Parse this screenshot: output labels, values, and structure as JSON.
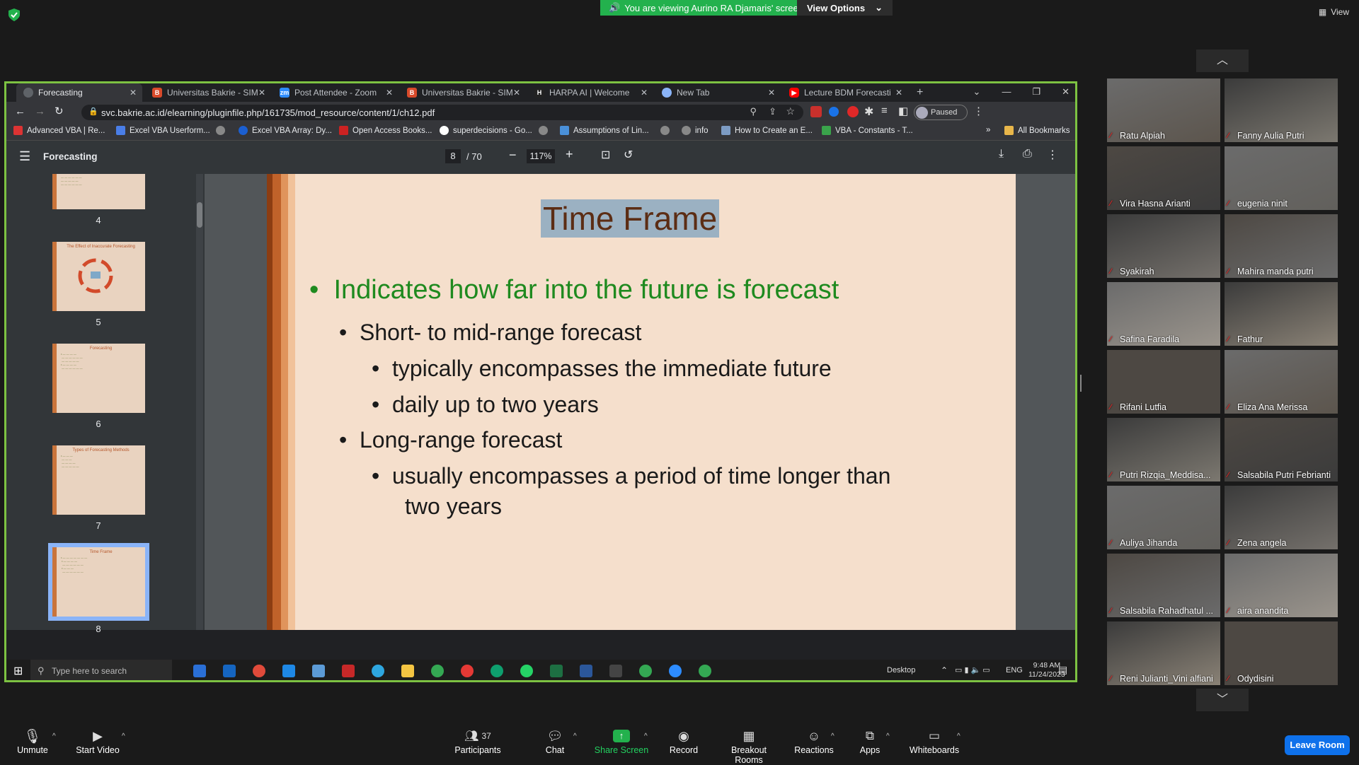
{
  "zoom": {
    "banner": "You are viewing Aurino RA Djamaris' screen",
    "view_options": "View Options",
    "view": "View",
    "bottom": {
      "unmute": "Unmute",
      "start_video": "Start Video",
      "participants": "Participants",
      "participants_count": "37",
      "chat": "Chat",
      "share_screen": "Share Screen",
      "record": "Record",
      "breakout": "Breakout Rooms",
      "reactions": "Reactions",
      "apps": "Apps",
      "whiteboards": "Whiteboards",
      "leave": "Leave Room"
    },
    "participants": [
      "Ratu Alpiah",
      "Fanny Aulia Putri",
      "Vira Hasna Arianti",
      "eugenia ninit",
      "Syakirah",
      "Mahira manda putri",
      "Safina Faradila",
      "Fathur",
      "Rifani Lutfia",
      "Eliza Ana Merissa",
      "Putri Rizqia_Meddisa...",
      "Salsabila Putri Febrianti",
      "Auliya Jihanda",
      "Zena angela",
      "Salsabila Rahadhatul ...",
      "aira anandita",
      "Reni Julianti_Vini alfiani",
      "Odydisini"
    ]
  },
  "browser": {
    "tabs": [
      "Forecasting",
      "Universitas Bakrie - SIM",
      "Post Attendee - Zoom",
      "Universitas Bakrie - SIM",
      "HARPA AI | Welcome",
      "New Tab",
      "Lecture BDM Forecasti"
    ],
    "url": "svc.bakrie.ac.id/elearning/pluginfile.php/161735/mod_resource/content/1/ch12.pdf",
    "profile_status": "Paused",
    "bookmarks": [
      "Advanced VBA | Re...",
      "Excel VBA Userform...",
      "Excel VBA Array: Dy...",
      "Open Access Books...",
      "superdecisions - Go...",
      "Assumptions of Lin...",
      "info",
      "How to Create an E...",
      "VBA - Constants - T..."
    ],
    "all_bookmarks": "All Bookmarks",
    "more": "»"
  },
  "pdf": {
    "title": "Forecasting",
    "page": "8",
    "total": "/ 70",
    "zoom": "117%",
    "thumb_numbers": [
      "4",
      "5",
      "6",
      "7",
      "8"
    ],
    "thumb_titles": [
      "",
      "The Effect of Inaccurate Forecasting",
      "Forecasting",
      "Types of Forecasting Methods",
      "Time Frame"
    ]
  },
  "slide": {
    "title": "Time Frame",
    "l1": "Indicates how far into the future is forecast",
    "l2a": "Short- to mid-range forecast",
    "l3a": "typically encompasses the immediate future",
    "l3b": "daily up to two years",
    "l2b": "Long-range forecast",
    "l3c_1": "usually encompasses a period of time longer than",
    "l3c_2": "two years"
  },
  "taskbar": {
    "search": "Type here to search",
    "desktop": "Desktop",
    "lang": "ENG",
    "time": "9:48 AM",
    "date": "11/24/2023"
  }
}
